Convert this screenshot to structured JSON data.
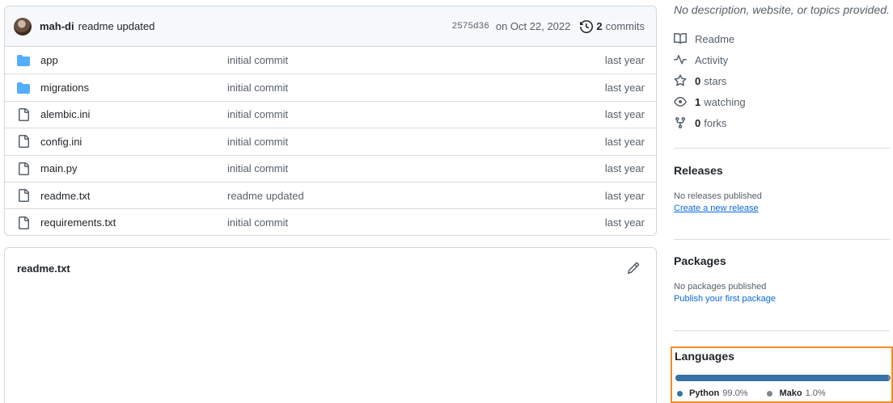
{
  "commit": {
    "author": "mah-di",
    "message": "readme updated",
    "sha": "2575d36",
    "date": "on Oct 22, 2022",
    "count": "2",
    "count_label": "commits"
  },
  "files": [
    {
      "type": "folder",
      "name": "app",
      "message": "initial commit",
      "age": "last year"
    },
    {
      "type": "folder",
      "name": "migrations",
      "message": "initial commit",
      "age": "last year"
    },
    {
      "type": "file",
      "name": "alembic.ini",
      "message": "initial commit",
      "age": "last year"
    },
    {
      "type": "file",
      "name": "config.ini",
      "message": "initial commit",
      "age": "last year"
    },
    {
      "type": "file",
      "name": "main.py",
      "message": "initial commit",
      "age": "last year"
    },
    {
      "type": "file",
      "name": "readme.txt",
      "message": "readme updated",
      "age": "last year"
    },
    {
      "type": "file",
      "name": "requirements.txt",
      "message": "initial commit",
      "age": "last year"
    }
  ],
  "readme": {
    "title": "readme.txt",
    "edit_icon": "pencil-icon"
  },
  "sidebar": {
    "about": "No description, website, or topics provided.",
    "readme_label": "Readme",
    "activity_label": "Activity",
    "stars": {
      "count": "0",
      "label": "stars"
    },
    "watching": {
      "count": "1",
      "label": "watching"
    },
    "forks": {
      "count": "0",
      "label": "forks"
    },
    "releases": {
      "title": "Releases",
      "empty": "No releases published",
      "link": "Create a new release"
    },
    "packages": {
      "title": "Packages",
      "empty": "No packages published",
      "link": "Publish your first package"
    },
    "languages": {
      "title": "Languages",
      "items": [
        {
          "name": "Python",
          "percent": "99.0%",
          "value": 99.0,
          "color": "#3572a5"
        },
        {
          "name": "Mako",
          "percent": "1.0%",
          "value": 1.0,
          "color": "#7e858d"
        }
      ]
    }
  }
}
